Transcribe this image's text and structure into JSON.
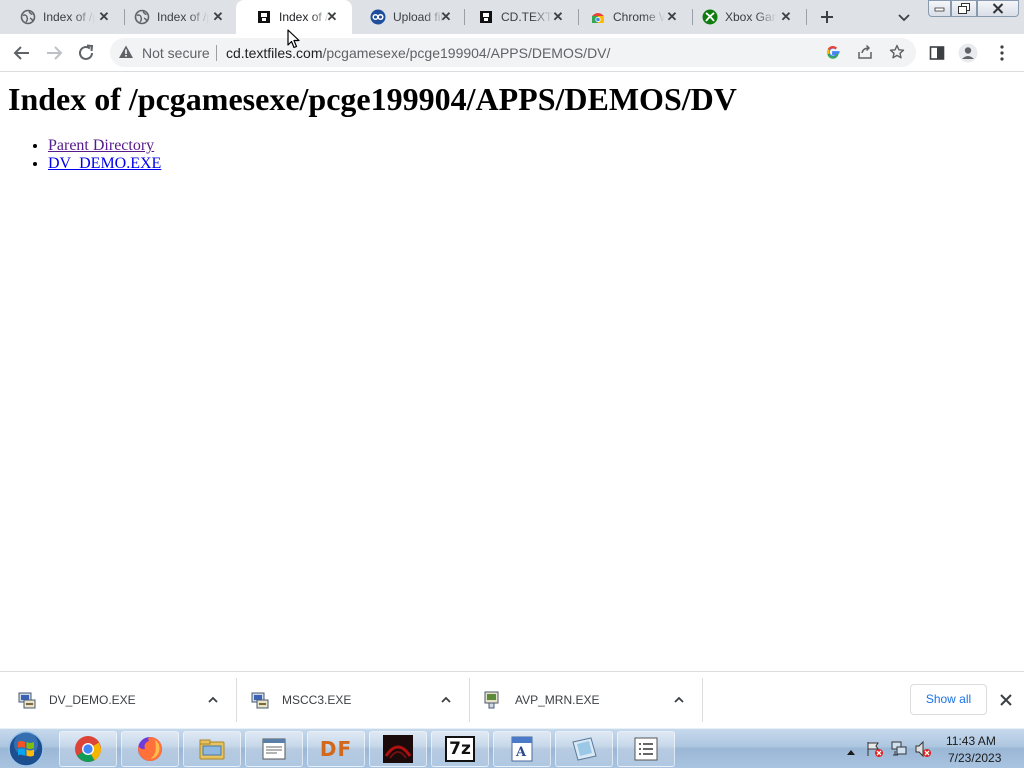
{
  "tabs": [
    {
      "title": "Index of /pcgamesexe",
      "icon": "globe-icon",
      "active": false
    },
    {
      "title": "Index of /pcgamesexe",
      "icon": "globe-icon",
      "active": false
    },
    {
      "title": "Index of /pcgamesexe",
      "icon": "textfiles-icon",
      "active": true
    },
    {
      "title": "Upload files",
      "icon": "upload-site-icon",
      "active": false
    },
    {
      "title": "CD.TEXTFILES.COM",
      "icon": "textfiles-icon",
      "active": false
    },
    {
      "title": "Chrome Web Store",
      "icon": "chrome-store-icon",
      "active": false
    },
    {
      "title": "Xbox Game Pass",
      "icon": "xbox-icon",
      "active": false
    }
  ],
  "toolbar": {
    "security_label": "Not secure",
    "url_host": "cd.textfiles.com",
    "url_path": "/pcgamesexe/pcge199904/APPS/DEMOS/DV/"
  },
  "page": {
    "heading": "Index of /pcgamesexe/pcge199904/APPS/DEMOS/DV",
    "links": [
      {
        "label": "Parent Directory",
        "visited": true
      },
      {
        "label": "DV_DEMO.EXE",
        "visited": false
      }
    ]
  },
  "downloads": {
    "items": [
      {
        "name": "DV_DEMO.EXE",
        "icon": "exe-setup-icon"
      },
      {
        "name": "MSCC3.EXE",
        "icon": "exe-setup-icon"
      },
      {
        "name": "AVP_MRN.EXE",
        "icon": "exe-setup-icon"
      }
    ],
    "show_all_label": "Show all"
  },
  "taskbar": {
    "items": [
      "chrome-icon",
      "firefox-icon",
      "explorer-icon",
      "notepad-icon",
      "df-icon",
      "game-icon",
      "7zip-icon",
      "wordpad-icon",
      "paint-icon",
      "list-icon"
    ],
    "df_label": "DF",
    "sevenzip_label": "7z",
    "time": "11:43 AM",
    "date": "7/23/2023"
  },
  "colors": {
    "link": "#0000ee",
    "visited_link": "#551a8b",
    "accent": "#1a73e8",
    "tabstrip": "#dee1e6"
  }
}
